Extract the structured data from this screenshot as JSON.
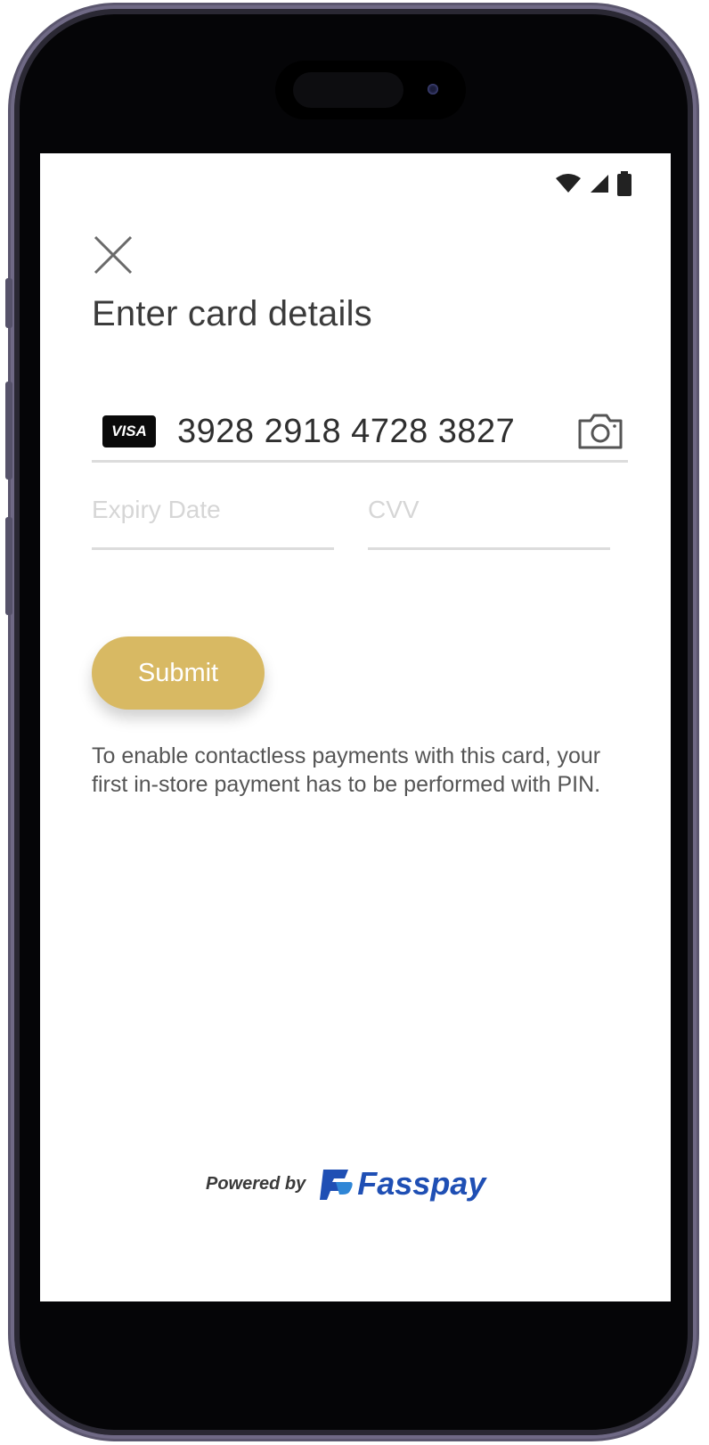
{
  "screen": {
    "title": "Enter card details",
    "card": {
      "brand": "VISA",
      "number": "3928 2918 4728 3827"
    },
    "expiry": {
      "placeholder": "Expiry Date",
      "value": ""
    },
    "cvv": {
      "placeholder": "CVV",
      "value": ""
    },
    "submit_label": "Submit",
    "notice": "To enable contactless payments with this card, your first in-store payment has to be performed with PIN.",
    "powered_by": {
      "label": "Powered by",
      "brand": "Fasspay"
    }
  },
  "colors": {
    "accent": "#d8b963",
    "brand": "#1f4fb4"
  },
  "icons": {
    "close": "close-icon",
    "camera": "camera-icon",
    "wifi": "wifi-icon",
    "signal": "signal-icon",
    "battery": "battery-icon"
  }
}
